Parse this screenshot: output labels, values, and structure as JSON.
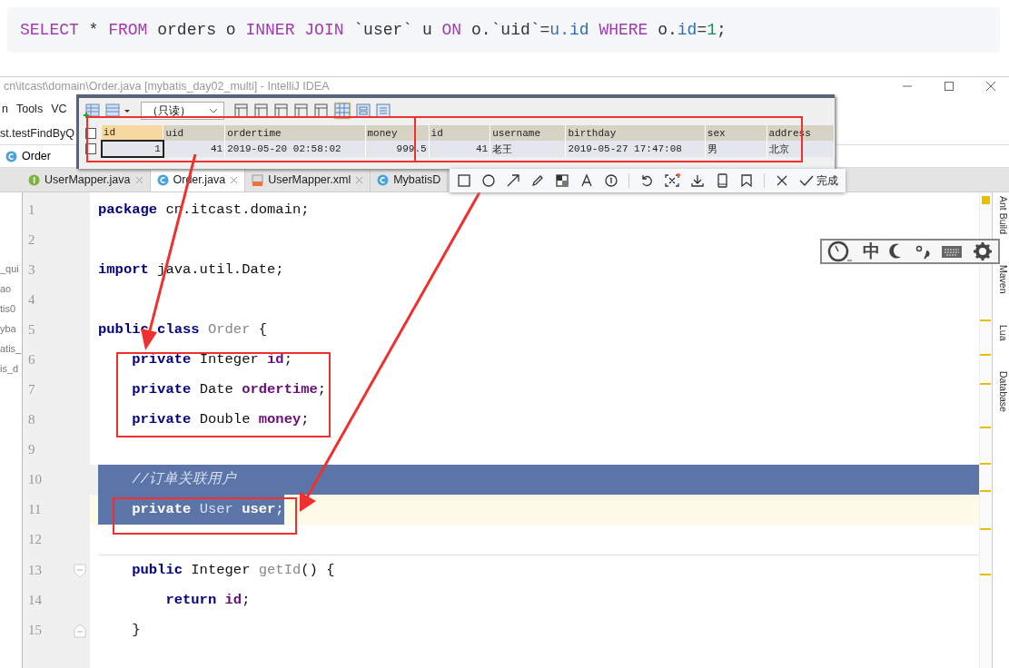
{
  "sql": {
    "tokens": [
      {
        "text": "SELECT",
        "kind": "keyword"
      },
      {
        "text": " * ",
        "kind": "plain"
      },
      {
        "text": "FROM",
        "kind": "keyword"
      },
      {
        "text": " orders o ",
        "kind": "plain"
      },
      {
        "text": "INNER JOIN",
        "kind": "keyword"
      },
      {
        "text": " `user` u ",
        "kind": "plain"
      },
      {
        "text": "ON",
        "kind": "keyword"
      },
      {
        "text": " o.`uid`=",
        "kind": "plain"
      },
      {
        "text": "u.id",
        "kind": "name"
      },
      {
        "text": " WHERE",
        "kind": "keyword"
      },
      {
        "text": " o.",
        "kind": "plain"
      },
      {
        "text": "id",
        "kind": "name"
      },
      {
        "text": "=",
        "kind": "plain"
      },
      {
        "text": "1",
        "kind": "number"
      },
      {
        "text": ";",
        "kind": "plain"
      }
    ]
  },
  "ide": {
    "title": "cn\\itcast\\domain\\Order.java [mybatis_day02_multi] - IntelliJ IDEA",
    "menu": [
      "n",
      "Tools",
      "VC"
    ],
    "run_config": "st.testFindByQ",
    "breadcrumb": "Order",
    "tabs": [
      {
        "label": "UserMapper.java",
        "kind": "interface",
        "selected": false
      },
      {
        "label": "Order.java",
        "kind": "class",
        "selected": true
      },
      {
        "label": "UserMapper.xml",
        "kind": "xml",
        "selected": false
      },
      {
        "label": "MybatisD",
        "kind": "class",
        "selected": false
      }
    ],
    "project_fragments": [
      "_qui",
      "ao",
      "tis0",
      "yba",
      "atis_",
      "is_d"
    ],
    "side_tools": [
      "Ant Build",
      "Maven",
      "Lua",
      "Database"
    ],
    "lines": [
      {
        "number": "1",
        "selected": false,
        "current": false,
        "tokens": [
          {
            "text": "package",
            "kind": "keyword"
          },
          {
            "text": " cn.itcast.domain;",
            "kind": "plain"
          }
        ]
      },
      {
        "number": "2",
        "selected": false,
        "current": false
      },
      {
        "number": "3",
        "selected": false,
        "current": false,
        "tokens": [
          {
            "text": "import",
            "kind": "keyword"
          },
          {
            "text": " java.util.Date;",
            "kind": "plain"
          }
        ]
      },
      {
        "number": "4",
        "selected": false,
        "current": false
      },
      {
        "number": "5",
        "selected": false,
        "current": false,
        "tokens": [
          {
            "text": "public class",
            "kind": "keyword"
          },
          {
            "text": " Order",
            "kind": "decl"
          },
          {
            "text": " {",
            "kind": "plain"
          }
        ]
      },
      {
        "number": "6",
        "selected": false,
        "current": false,
        "tokens": [
          {
            "text": "    private",
            "kind": "keyword"
          },
          {
            "text": " Integer ",
            "kind": "plain"
          },
          {
            "text": "id",
            "kind": "field"
          },
          {
            "text": ";",
            "kind": "plain"
          }
        ]
      },
      {
        "number": "7",
        "selected": false,
        "current": false,
        "tokens": [
          {
            "text": "    private",
            "kind": "keyword"
          },
          {
            "text": " Date ",
            "kind": "plain"
          },
          {
            "text": "ordertime",
            "kind": "field"
          },
          {
            "text": ";",
            "kind": "plain"
          }
        ]
      },
      {
        "number": "8",
        "selected": false,
        "current": false,
        "tokens": [
          {
            "text": "    private",
            "kind": "keyword"
          },
          {
            "text": " Double ",
            "kind": "plain"
          },
          {
            "text": "money",
            "kind": "field"
          },
          {
            "text": ";",
            "kind": "plain"
          }
        ]
      },
      {
        "number": "9",
        "selected": false,
        "current": false
      },
      {
        "number": "10",
        "selected": true,
        "current": false,
        "tokens": [
          {
            "text": "    //订单关联用户",
            "kind": "comment"
          }
        ]
      },
      {
        "number": "11",
        "selected": true,
        "current": true,
        "tokens": [
          {
            "text": "    private",
            "kind": "keyword"
          },
          {
            "text": " User ",
            "kind": "decl"
          },
          {
            "text": "user",
            "kind": "field"
          },
          {
            "text": ";",
            "kind": "plain"
          }
        ]
      },
      {
        "number": "12",
        "selected": false,
        "current": false
      },
      {
        "number": "13",
        "selected": false,
        "current": false,
        "tokens": [
          {
            "text": "    public",
            "kind": "keyword"
          },
          {
            "text": " Integer ",
            "kind": "plain"
          },
          {
            "text": "getId",
            "kind": "decl"
          },
          {
            "text": "() {",
            "kind": "plain"
          }
        ]
      },
      {
        "number": "14",
        "selected": false,
        "current": false,
        "tokens": [
          {
            "text": "        return",
            "kind": "keyword"
          },
          {
            "text": " id",
            "kind": "field"
          },
          {
            "text": ";",
            "kind": "plain"
          }
        ]
      },
      {
        "number": "15",
        "selected": false,
        "current": false,
        "tokens": [
          {
            "text": "    }",
            "kind": "plain"
          }
        ]
      }
    ]
  },
  "data_grid": {
    "mode": "（只读）",
    "select_all_checked": false,
    "columns": [
      "id",
      "uid",
      "ordertime",
      "money",
      "id",
      "username",
      "birthday",
      "sex",
      "address"
    ],
    "rows": [
      {
        "checked": false,
        "cells": [
          "1",
          "41",
          "2019-05-20 02:58:02",
          "999.5",
          "41",
          "老王",
          "2019-05-27 17:47:08",
          "男",
          "北京"
        ]
      }
    ]
  },
  "screenshot_toolbar": {
    "done": "完成"
  },
  "ime_bar": {
    "mode": "中"
  }
}
